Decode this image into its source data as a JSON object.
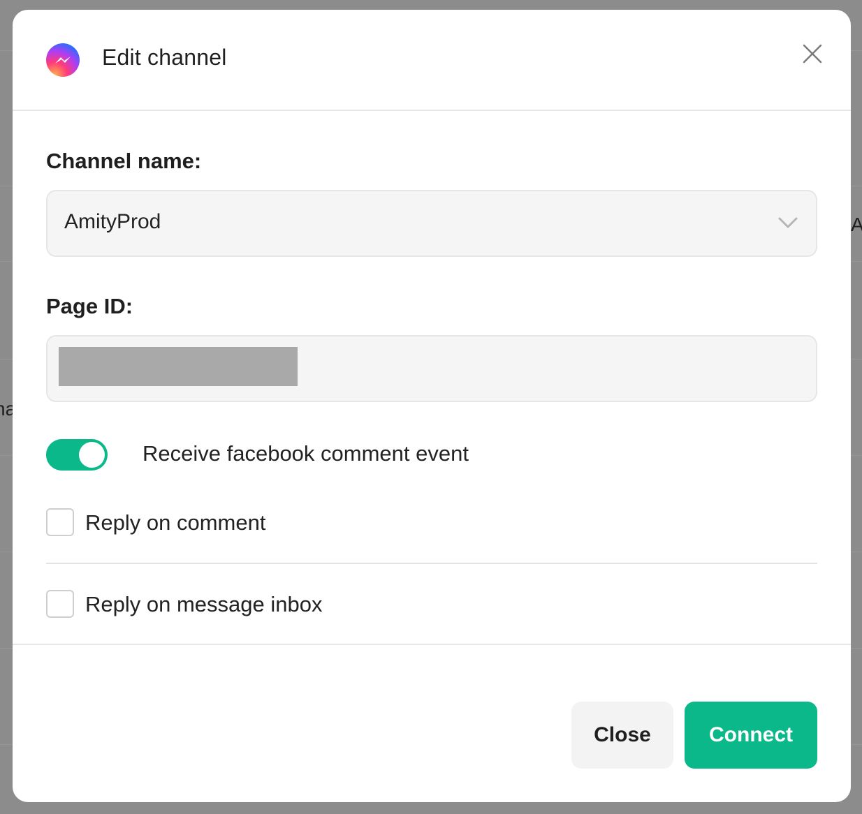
{
  "background": {
    "fragment_right": "A",
    "fragment_left": "na"
  },
  "modal": {
    "title": "Edit channel",
    "brand_icon": "messenger-icon",
    "close_icon": "close-icon"
  },
  "form": {
    "channel_name": {
      "label": "Channel name:",
      "value": "AmityProd",
      "icon": "chevron-down-icon"
    },
    "page_id": {
      "label": "Page ID:",
      "value_redacted": true
    },
    "toggle": {
      "label": "Receive facebook comment event",
      "on": true
    },
    "checkboxes": [
      {
        "label": "Reply on comment",
        "checked": false
      },
      {
        "label": "Reply on message inbox",
        "checked": false
      }
    ]
  },
  "footer": {
    "close_label": "Close",
    "connect_label": "Connect"
  },
  "colors": {
    "accent": "#0ab88a",
    "overlay": "#8c8c8c",
    "field_bg": "#f5f5f5"
  }
}
